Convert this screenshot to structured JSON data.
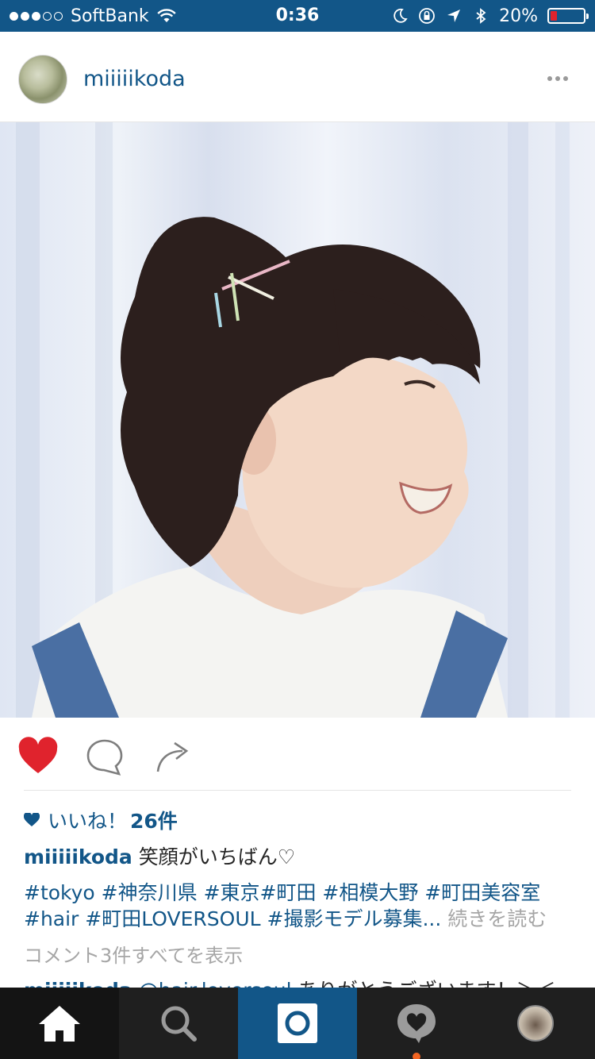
{
  "status_bar": {
    "carrier": "SoftBank",
    "time": "0:36",
    "battery_percent": "20%",
    "battery_level": 0.2,
    "signal_dots_filled": 3,
    "signal_dots_total": 5,
    "icons": [
      "wifi-icon",
      "moon-icon",
      "rotation-lock-icon",
      "location-arrow-icon",
      "bluetooth-icon",
      "battery-icon"
    ]
  },
  "post": {
    "username": "miiiiikoda",
    "more_icon": "more-dots-icon",
    "photo_alt_icon": "post-photo"
  },
  "actions": {
    "like_icon": "heart-filled-icon",
    "comment_icon": "comment-bubble-icon",
    "share_icon": "share-arrow-icon"
  },
  "likes": {
    "label": "いいね！",
    "count": "26件"
  },
  "caption": {
    "username": "miiiiikoda",
    "text": "笑顔がいちばん♡"
  },
  "hashtags": {
    "line1": "#tokyo #神奈川県 #東京#町田 #相模大野 #町田美容室",
    "line2": "#hair #町田LOVERSOUL #撮影モデル募集...",
    "read_more": " 続きを読む"
  },
  "comments": {
    "view_all": "コメント3件すべてを表示",
    "first_username": "miiiiikoda",
    "first_mention": "@hair.loversoul",
    "first_text": " ありがとうございます！＞＜"
  },
  "tabbar": {
    "items": [
      "home-icon",
      "search-icon",
      "camera-icon",
      "activity-heart-icon",
      "profile-avatar"
    ]
  },
  "colors": {
    "brand": "#125688",
    "like_red": "#e0232d",
    "tabbar_bg": "#1f1f1f",
    "notification_dot": "#f26522"
  }
}
